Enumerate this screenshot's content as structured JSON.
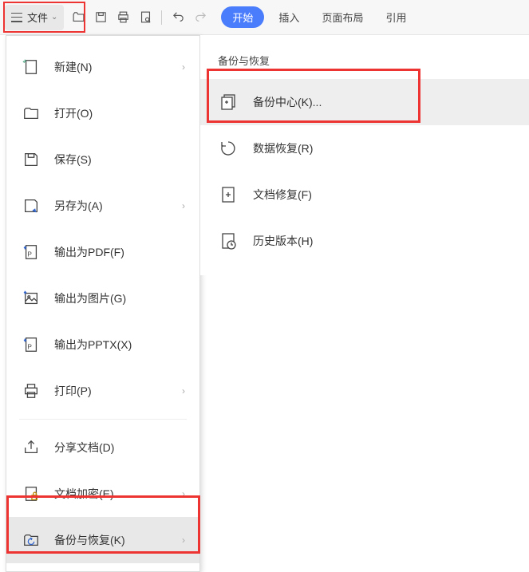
{
  "toolbar": {
    "file_label": "文件"
  },
  "tabs": {
    "start": "开始",
    "insert": "插入",
    "layout": "页面布局",
    "reference": "引用"
  },
  "menu": {
    "new": "新建(N)",
    "open": "打开(O)",
    "save": "保存(S)",
    "saveas": "另存为(A)",
    "export_pdf": "输出为PDF(F)",
    "export_img": "输出为图片(G)",
    "export_pptx": "输出为PPTX(X)",
    "print": "打印(P)",
    "share": "分享文档(D)",
    "encrypt": "文档加密(E)",
    "backup": "备份与恢复(K)"
  },
  "submenu": {
    "header": "备份与恢复",
    "backup_center": "备份中心(K)...",
    "data_recovery": "数据恢复(R)",
    "doc_repair": "文档修复(F)",
    "history": "历史版本(H)"
  }
}
